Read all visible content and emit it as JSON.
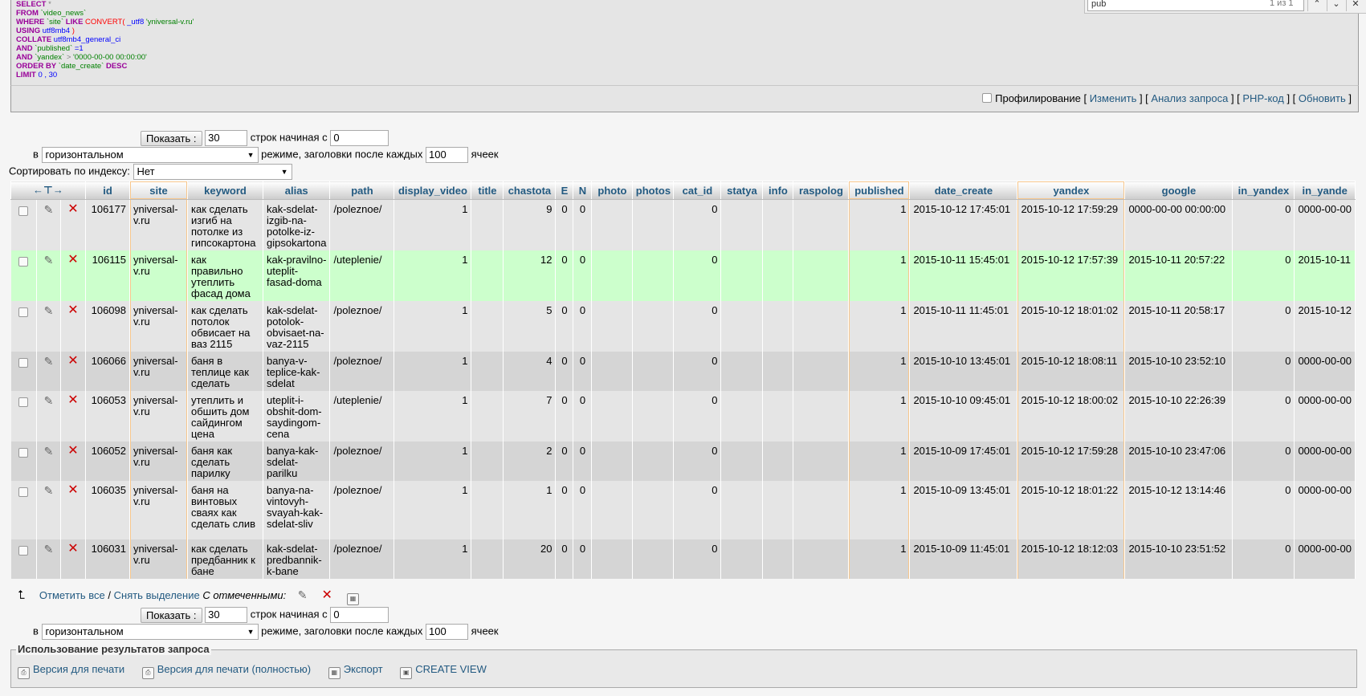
{
  "sql": {
    "l1_kw": "SELECT",
    "l1_rest": " *",
    "l2_kw": "FROM",
    "l2_tbl": " `video_news`",
    "l3_kw": "WHERE",
    "l3_col": " `site`",
    "l3_like": " LIKE",
    "l3_fn": " CONVERT(",
    "l3_typ": " _utf8",
    "l3_str": " 'yniversal-v.ru'",
    "l4_kw": "USING",
    "l4_typ": " utf8mb4",
    "l4_close": " )",
    "l5_kw": "COLLATE",
    "l5_typ": " utf8mb4_general_ci",
    "l6_kw": "AND",
    "l6_col": " `published`",
    "l6_op": " =1",
    "l7_kw": "AND",
    "l7_col": " `yandex`",
    "l7_op": " >",
    "l7_str": " '0000-00-00 00:00:00'",
    "l8_kw": "ORDER BY",
    "l8_col": " `date_create`",
    "l8_desc": " DESC",
    "l9_kw": "LIMIT",
    "l9_val": " 0 , 30"
  },
  "findbar": {
    "value": "pub",
    "count": "1 из 1",
    "up": "⌃",
    "down": "⌄",
    "close": "✕"
  },
  "actions": {
    "profiling": "Профилирование",
    "edit": "Изменить",
    "explain": "Анализ запроса",
    "php": "PHP-код",
    "refresh": "Обновить"
  },
  "nav": {
    "show_btn": "Показать :",
    "rows": "30",
    "rows_from_label": "строк начиная с",
    "start": "0",
    "in_label": "в",
    "mode": "горизонтальном",
    "mode_label": "режиме, заголовки после каждых",
    "repeat": "100",
    "cells_label": "ячеек",
    "sort_label": "Сортировать по индексу:",
    "sort_value": "Нет"
  },
  "columns": {
    "arrows": "←⊤→",
    "id": "id",
    "site": "site",
    "keyword": "keyword",
    "alias": "alias",
    "path": "path",
    "display_video": "display_video",
    "title": "title",
    "chastota": "chastota",
    "E": "E",
    "N": "N",
    "photo": "photo",
    "photos": "photos",
    "cat_id": "cat_id",
    "statya": "statya",
    "info": "info",
    "raspolog": "raspolog",
    "published": "published",
    "date_create": "date_create",
    "yandex": "yandex",
    "google": "google",
    "in_yandex": "in_yandex",
    "in_yande2": "in_yande"
  },
  "rows": [
    {
      "id": "106177",
      "site": "yniversal-v.ru",
      "keyword": "как сделать изгиб на потолке из гипсокартона",
      "alias": "kak-sdelat-izgib-na-potolke-iz-gipsokartona",
      "path": "/poleznoe/",
      "display_video": "1",
      "chastota": "9",
      "E": "0",
      "N": "0",
      "cat_id": "0",
      "published": "1",
      "date_create": "2015-10-12 17:45:01",
      "yandex": "2015-10-12 17:59:29",
      "google": "0000-00-00 00:00:00",
      "in_yandex": "0",
      "in_yande2": "0000-00-00"
    },
    {
      "id": "106115",
      "site": "yniversal-v.ru",
      "keyword": "как правильно утеплить фасад дома",
      "alias": "kak-pravilno-uteplit-fasad-doma",
      "path": "/uteplenie/",
      "display_video": "1",
      "chastota": "12",
      "E": "0",
      "N": "0",
      "cat_id": "0",
      "published": "1",
      "date_create": "2015-10-11 15:45:01",
      "yandex": "2015-10-12 17:57:39",
      "google": "2015-10-11 20:57:22",
      "in_yandex": "0",
      "in_yande2": "2015-10-11"
    },
    {
      "id": "106098",
      "site": "yniversal-v.ru",
      "keyword": "как сделать потолок обвисает на ваз 2115",
      "alias": "kak-sdelat-potolok-obvisaet-na-vaz-2115",
      "path": "/poleznoe/",
      "display_video": "1",
      "chastota": "5",
      "E": "0",
      "N": "0",
      "cat_id": "0",
      "published": "1",
      "date_create": "2015-10-11 11:45:01",
      "yandex": "2015-10-12 18:01:02",
      "google": "2015-10-11 20:58:17",
      "in_yandex": "0",
      "in_yande2": "2015-10-12"
    },
    {
      "id": "106066",
      "site": "yniversal-v.ru",
      "keyword": "баня в теплице как сделать",
      "alias": "banya-v-teplice-kak-sdelat",
      "path": "/poleznoe/",
      "display_video": "1",
      "chastota": "4",
      "E": "0",
      "N": "0",
      "cat_id": "0",
      "published": "1",
      "date_create": "2015-10-10 13:45:01",
      "yandex": "2015-10-12 18:08:11",
      "google": "2015-10-10 23:52:10",
      "in_yandex": "0",
      "in_yande2": "0000-00-00"
    },
    {
      "id": "106053",
      "site": "yniversal-v.ru",
      "keyword": "утеплить и обшить дом сайдингом цена",
      "alias": "uteplit-i-obshit-dom-saydingom-cena",
      "path": "/uteplenie/",
      "display_video": "1",
      "chastota": "7",
      "E": "0",
      "N": "0",
      "cat_id": "0",
      "published": "1",
      "date_create": "2015-10-10 09:45:01",
      "yandex": "2015-10-12 18:00:02",
      "google": "2015-10-10 22:26:39",
      "in_yandex": "0",
      "in_yande2": "0000-00-00"
    },
    {
      "id": "106052",
      "site": "yniversal-v.ru",
      "keyword": "баня как сделать парилку",
      "alias": "banya-kak-sdelat-parilku",
      "path": "/poleznoe/",
      "display_video": "1",
      "chastota": "2",
      "E": "0",
      "N": "0",
      "cat_id": "0",
      "published": "1",
      "date_create": "2015-10-09 17:45:01",
      "yandex": "2015-10-12 17:59:28",
      "google": "2015-10-10 23:47:06",
      "in_yandex": "0",
      "in_yande2": "0000-00-00"
    },
    {
      "id": "106035",
      "site": "yniversal-v.ru",
      "keyword": "баня на винтовых сваях как сделать слив",
      "alias": "banya-na-vintovyh-svayah-kak-sdelat-sliv",
      "path": "/poleznoe/",
      "display_video": "1",
      "chastota": "1",
      "E": "0",
      "N": "0",
      "cat_id": "0",
      "published": "1",
      "date_create": "2015-10-09 13:45:01",
      "yandex": "2015-10-12 18:01:22",
      "google": "2015-10-12 13:14:46",
      "in_yandex": "0",
      "in_yande2": "0000-00-00"
    },
    {
      "id": "106031",
      "site": "yniversal-v.ru",
      "keyword": "как сделать предбанник к бане",
      "alias": "kak-sdelat-predbannik-k-bane",
      "path": "/poleznoe/",
      "display_video": "1",
      "chastota": "20",
      "E": "0",
      "N": "0",
      "cat_id": "0",
      "published": "1",
      "date_create": "2015-10-09 11:45:01",
      "yandex": "2015-10-12 18:12:03",
      "google": "2015-10-10 23:51:52",
      "in_yandex": "0",
      "in_yande2": "0000-00-00"
    }
  ],
  "bulk": {
    "select_all": "Отметить все",
    "sep": " / ",
    "unselect": "Снять выделение",
    "with_selected": "С отмеченными:"
  },
  "usage": {
    "legend": "Использование результатов запроса",
    "print": "Версия для печати",
    "print_full": "Версия для печати (полностью)",
    "export": "Экспорт",
    "create_view": "CREATE VIEW"
  },
  "colors": {
    "highlight_row": "#ccffcc",
    "link": "#235a81",
    "delete": "#cc0000"
  }
}
